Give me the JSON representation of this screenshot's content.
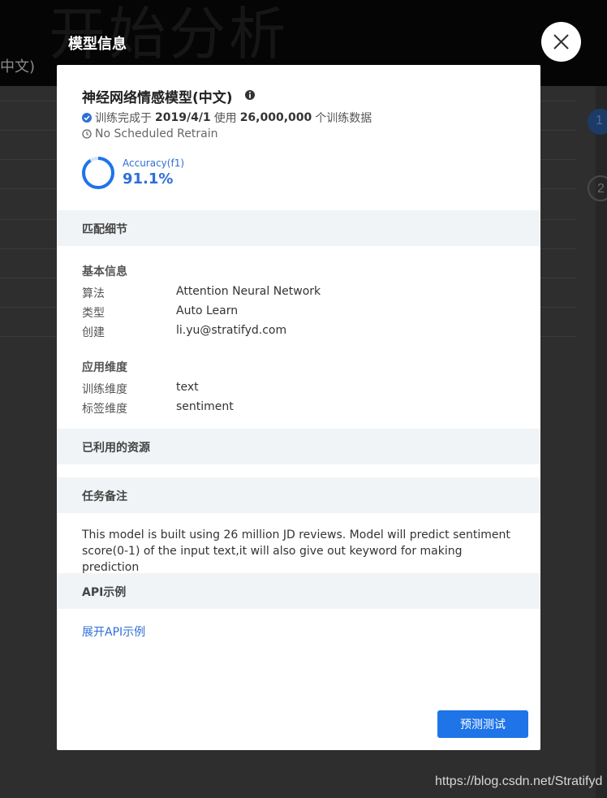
{
  "background": {
    "big_text": "开始分析",
    "sub_text": "中文)",
    "step_1": "1",
    "step_2": "2"
  },
  "overlay": {
    "title": "模型信息",
    "close_icon": "close-icon"
  },
  "model": {
    "name": "神经网络情感模型(中文)",
    "status_prefix": "训练完成于",
    "trained_date": "2019/4/1",
    "status_mid": "使用",
    "train_count": "26,000,000",
    "status_suffix": "个训练数据",
    "retrain": "No Scheduled Retrain",
    "accuracy_label": "Accuracy(f1)",
    "accuracy_value": "91.1%",
    "accuracy_fraction": 0.911
  },
  "sections": {
    "match_details": "匹配细节",
    "basic_info_title": "基本信息",
    "basic_info": [
      {
        "key": "算法",
        "value": "Attention Neural Network"
      },
      {
        "key": "类型",
        "value": "Auto Learn"
      },
      {
        "key": "创建",
        "value": "li.yu@stratifyd.com"
      }
    ],
    "dimensions_title": "应用维度",
    "dimensions": [
      {
        "key": "训练维度",
        "value": "text"
      },
      {
        "key": "标签维度",
        "value": "sentiment"
      }
    ],
    "resources": "已利用的资源",
    "notes_title": "任务备注",
    "notes_text": "This model is built using 26 million JD reviews. Model will predict sentiment score(0-1) of the input text,it will also give out keyword for making prediction",
    "api_title": "API示例",
    "api_link": "展开API示例"
  },
  "actions": {
    "predict_button": "预测测试"
  },
  "watermark": "https://blog.csdn.net/Stratifyd",
  "colors": {
    "accent": "#1f74e8",
    "link": "#2f6fd6",
    "section_bg": "#f1f4f6",
    "backdrop": "#2e2e2e"
  }
}
